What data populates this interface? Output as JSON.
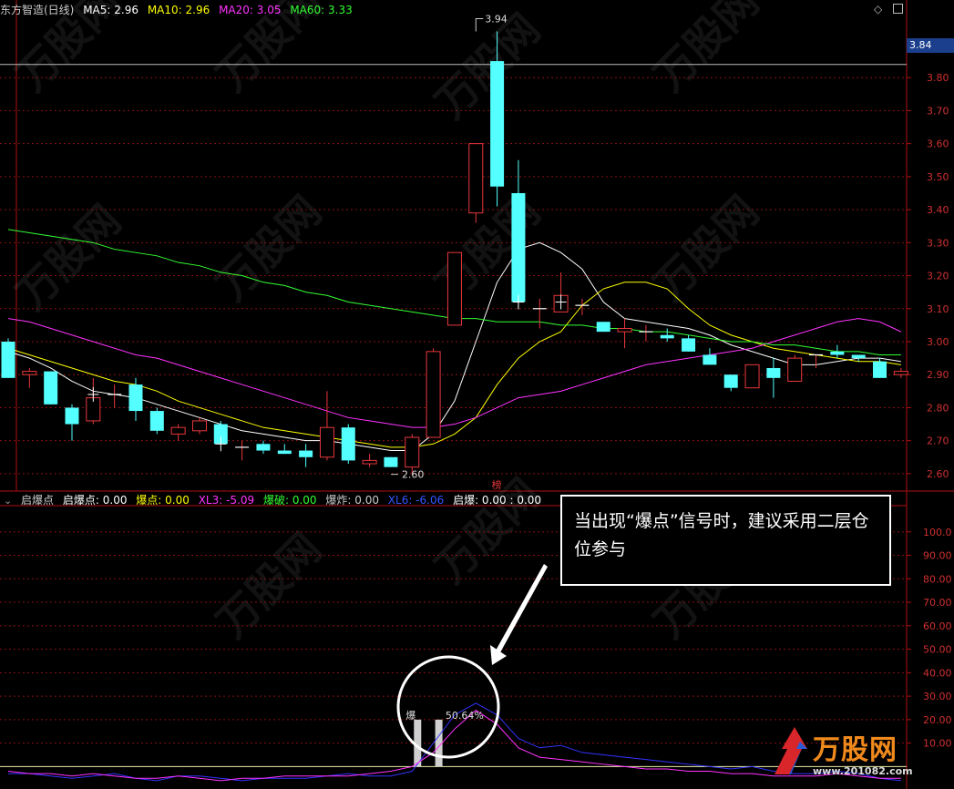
{
  "top_header": {
    "title": "东方智造(日线)",
    "items": [
      {
        "label": "MA5: 2.96",
        "color": "#ffffff"
      },
      {
        "label": "MA10: 2.96",
        "color": "#ffff00"
      },
      {
        "label": "MA20: 3.05",
        "color": "#ff33ff"
      },
      {
        "label": "MA60: 3.33",
        "color": "#33ff33"
      }
    ]
  },
  "bottom_header": {
    "title": "启爆点",
    "items": [
      {
        "label": "启爆点: 0.00",
        "color": "#ffffff"
      },
      {
        "label": "爆点: 0.00",
        "color": "#ffff00"
      },
      {
        "label": "XL3: -5.09",
        "color": "#ff33ff"
      },
      {
        "label": "爆破: 0.00",
        "color": "#33ff33"
      },
      {
        "label": "爆炸: 0.00",
        "color": "#cccccc"
      },
      {
        "label": "XL6: -6.06",
        "color": "#3333ff"
      },
      {
        "label": "启爆: 0.00 : 0.00",
        "color": "#ffffff"
      }
    ]
  },
  "current_price": "3.84",
  "callout_text": "当出现“爆点”信号时，建议采用二层仓位参与",
  "logo": {
    "name": "万股网",
    "url": "www.201082.com"
  },
  "watermark": "万股网",
  "chart_data": [
    {
      "type": "candlestick",
      "ylim": [
        2.55,
        3.98
      ],
      "yticks": [
        "3.80",
        "3.70",
        "3.60",
        "3.50",
        "3.40",
        "3.30",
        "3.20",
        "3.10",
        "3.00",
        "2.90",
        "2.80",
        "2.70",
        "2.60"
      ],
      "reference_line": 3.84,
      "annotations": [
        {
          "text": "3.94",
          "index": 22,
          "value": 3.94
        },
        {
          "text": "2.60",
          "index": 18,
          "value": 2.62
        },
        {
          "text": "榜",
          "index": 23
        }
      ],
      "candles": [
        {
          "o": 3.0,
          "h": 3.01,
          "l": 2.89,
          "c": 2.89
        },
        {
          "o": 2.9,
          "h": 2.92,
          "l": 2.86,
          "c": 2.91
        },
        {
          "o": 2.91,
          "h": 2.91,
          "l": 2.81,
          "c": 2.81
        },
        {
          "o": 2.8,
          "h": 2.81,
          "l": 2.7,
          "c": 2.75
        },
        {
          "o": 2.76,
          "h": 2.89,
          "l": 2.75,
          "c": 2.83
        },
        {
          "o": 2.84,
          "h": 2.87,
          "l": 2.8,
          "c": 2.84
        },
        {
          "o": 2.87,
          "h": 2.89,
          "l": 2.76,
          "c": 2.79
        },
        {
          "o": 2.79,
          "h": 2.8,
          "l": 2.72,
          "c": 2.73
        },
        {
          "o": 2.72,
          "h": 2.75,
          "l": 2.7,
          "c": 2.74
        },
        {
          "o": 2.73,
          "h": 2.77,
          "l": 2.72,
          "c": 2.76
        },
        {
          "o": 2.75,
          "h": 2.76,
          "l": 2.69,
          "c": 2.69
        },
        {
          "o": 2.68,
          "h": 2.7,
          "l": 2.64,
          "c": 2.68
        },
        {
          "o": 2.69,
          "h": 2.7,
          "l": 2.66,
          "c": 2.67
        },
        {
          "o": 2.67,
          "h": 2.69,
          "l": 2.66,
          "c": 2.66
        },
        {
          "o": 2.67,
          "h": 2.69,
          "l": 2.62,
          "c": 2.65
        },
        {
          "o": 2.65,
          "h": 2.85,
          "l": 2.64,
          "c": 2.74
        },
        {
          "o": 2.74,
          "h": 2.75,
          "l": 2.63,
          "c": 2.64
        },
        {
          "o": 2.63,
          "h": 2.66,
          "l": 2.62,
          "c": 2.64
        },
        {
          "o": 2.65,
          "h": 2.65,
          "l": 2.62,
          "c": 2.62
        },
        {
          "o": 2.62,
          "h": 2.72,
          "l": 2.6,
          "c": 2.71
        },
        {
          "o": 2.71,
          "h": 2.98,
          "l": 2.71,
          "c": 2.97
        },
        {
          "o": 3.05,
          "h": 3.27,
          "l": 3.05,
          "c": 3.27
        },
        {
          "o": 3.39,
          "h": 3.6,
          "l": 3.36,
          "c": 3.6
        },
        {
          "o": 3.85,
          "h": 3.94,
          "l": 3.41,
          "c": 3.47
        },
        {
          "o": 3.45,
          "h": 3.55,
          "l": 3.12,
          "c": 3.12
        },
        {
          "o": 3.1,
          "h": 3.13,
          "l": 3.04,
          "c": 3.1
        },
        {
          "o": 3.09,
          "h": 3.21,
          "l": 3.09,
          "c": 3.14
        },
        {
          "o": 3.11,
          "h": 3.13,
          "l": 3.08,
          "c": 3.11
        },
        {
          "o": 3.06,
          "h": 3.06,
          "l": 3.03,
          "c": 3.03
        },
        {
          "o": 3.03,
          "h": 3.07,
          "l": 2.98,
          "c": 3.04
        },
        {
          "o": 3.03,
          "h": 3.05,
          "l": 3.0,
          "c": 3.03
        },
        {
          "o": 3.02,
          "h": 3.04,
          "l": 3.0,
          "c": 3.01
        },
        {
          "o": 3.01,
          "h": 3.02,
          "l": 2.97,
          "c": 2.97
        },
        {
          "o": 2.96,
          "h": 2.98,
          "l": 2.93,
          "c": 2.93
        },
        {
          "o": 2.9,
          "h": 2.9,
          "l": 2.85,
          "c": 2.86
        },
        {
          "o": 2.86,
          "h": 2.93,
          "l": 2.86,
          "c": 2.93
        },
        {
          "o": 2.92,
          "h": 2.95,
          "l": 2.83,
          "c": 2.89
        },
        {
          "o": 2.88,
          "h": 2.96,
          "l": 2.88,
          "c": 2.95
        },
        {
          "o": 2.96,
          "h": 2.96,
          "l": 2.92,
          "c": 2.96
        },
        {
          "o": 2.97,
          "h": 2.99,
          "l": 2.95,
          "c": 2.96
        },
        {
          "o": 2.96,
          "h": 2.96,
          "l": 2.94,
          "c": 2.95
        },
        {
          "o": 2.94,
          "h": 2.95,
          "l": 2.89,
          "c": 2.89
        },
        {
          "o": 2.9,
          "h": 2.92,
          "l": 2.89,
          "c": 2.91
        }
      ],
      "ma_series": [
        {
          "name": "MA5",
          "color": "#ffffff",
          "values": [
            2.97,
            2.95,
            2.92,
            2.88,
            2.85,
            2.84,
            2.83,
            2.81,
            2.79,
            2.77,
            2.75,
            2.73,
            2.72,
            2.71,
            2.7,
            2.7,
            2.69,
            2.68,
            2.67,
            2.67,
            2.72,
            2.82,
            3.0,
            3.18,
            3.28,
            3.3,
            3.27,
            3.22,
            3.12,
            3.07,
            3.06,
            3.05,
            3.04,
            3.02,
            2.99,
            2.97,
            2.95,
            2.93,
            2.93,
            2.94,
            2.95,
            2.95,
            2.94
          ]
        },
        {
          "name": "MA10",
          "color": "#ffff00",
          "values": [
            2.98,
            2.96,
            2.94,
            2.92,
            2.9,
            2.88,
            2.87,
            2.85,
            2.82,
            2.8,
            2.78,
            2.76,
            2.74,
            2.73,
            2.72,
            2.71,
            2.7,
            2.69,
            2.68,
            2.68,
            2.69,
            2.72,
            2.77,
            2.87,
            2.95,
            3.0,
            3.03,
            3.11,
            3.16,
            3.18,
            3.18,
            3.16,
            3.1,
            3.05,
            3.02,
            3.0,
            2.98,
            2.97,
            2.96,
            2.95,
            2.94,
            2.94,
            2.93
          ]
        },
        {
          "name": "MA20",
          "color": "#ff33ff",
          "values": [
            3.07,
            3.06,
            3.04,
            3.02,
            3.0,
            2.98,
            2.96,
            2.95,
            2.93,
            2.91,
            2.89,
            2.87,
            2.85,
            2.83,
            2.81,
            2.79,
            2.77,
            2.76,
            2.75,
            2.74,
            2.74,
            2.75,
            2.77,
            2.8,
            2.83,
            2.84,
            2.85,
            2.87,
            2.89,
            2.91,
            2.93,
            2.94,
            2.95,
            2.96,
            2.97,
            2.98,
            3.0,
            3.02,
            3.04,
            3.06,
            3.07,
            3.06,
            3.03
          ]
        },
        {
          "name": "MA60",
          "color": "#33ff33",
          "values": [
            3.34,
            3.33,
            3.32,
            3.31,
            3.3,
            3.28,
            3.27,
            3.26,
            3.24,
            3.23,
            3.21,
            3.2,
            3.18,
            3.17,
            3.15,
            3.14,
            3.12,
            3.11,
            3.1,
            3.09,
            3.08,
            3.07,
            3.07,
            3.06,
            3.06,
            3.06,
            3.05,
            3.05,
            3.04,
            3.04,
            3.03,
            3.03,
            3.02,
            3.01,
            3.0,
            3.0,
            2.99,
            2.99,
            2.98,
            2.97,
            2.97,
            2.96,
            2.96
          ]
        }
      ]
    },
    {
      "type": "line",
      "ylim": [
        -8,
        110
      ],
      "yticks": [
        "100.0",
        "90.00",
        "80.00",
        "70.00",
        "60.00",
        "50.00",
        "40.00",
        "30.00",
        "20.00",
        "10.00"
      ],
      "reference_value": 0,
      "labels": [
        {
          "text": "爆",
          "index": 19,
          "value": 18
        },
        {
          "text": "50.64%",
          "index": 21,
          "value": 18
        }
      ],
      "signal_bars": {
        "indices": [
          19,
          20
        ],
        "value": 20,
        "color": "#d0d0d0"
      },
      "series": [
        {
          "name": "XL6",
          "color": "#3333ff",
          "values": [
            -3,
            -3,
            -4,
            -5,
            -4,
            -3,
            -5,
            -6,
            -4,
            -4,
            -5,
            -6,
            -5,
            -5,
            -5,
            -4,
            -3,
            -4,
            -4,
            -2,
            10,
            22,
            27,
            22,
            12,
            8,
            9,
            6,
            5,
            4,
            3,
            2,
            1,
            0,
            -1,
            0,
            -2,
            -3,
            -3,
            -2,
            -3,
            -5,
            -6
          ]
        },
        {
          "name": "XL3",
          "color": "#ff33ff",
          "values": [
            -2,
            -3,
            -3,
            -4,
            -3,
            -4,
            -5,
            -5,
            -4,
            -5,
            -6,
            -5,
            -5,
            -4,
            -4,
            -4,
            -4,
            -3,
            -2,
            0,
            6,
            16,
            24,
            18,
            8,
            4,
            3,
            2,
            1,
            0,
            -1,
            -1,
            -2,
            -2,
            -3,
            -3,
            -4,
            -4,
            -4,
            -3,
            -4,
            -5,
            -5
          ]
        }
      ]
    }
  ]
}
